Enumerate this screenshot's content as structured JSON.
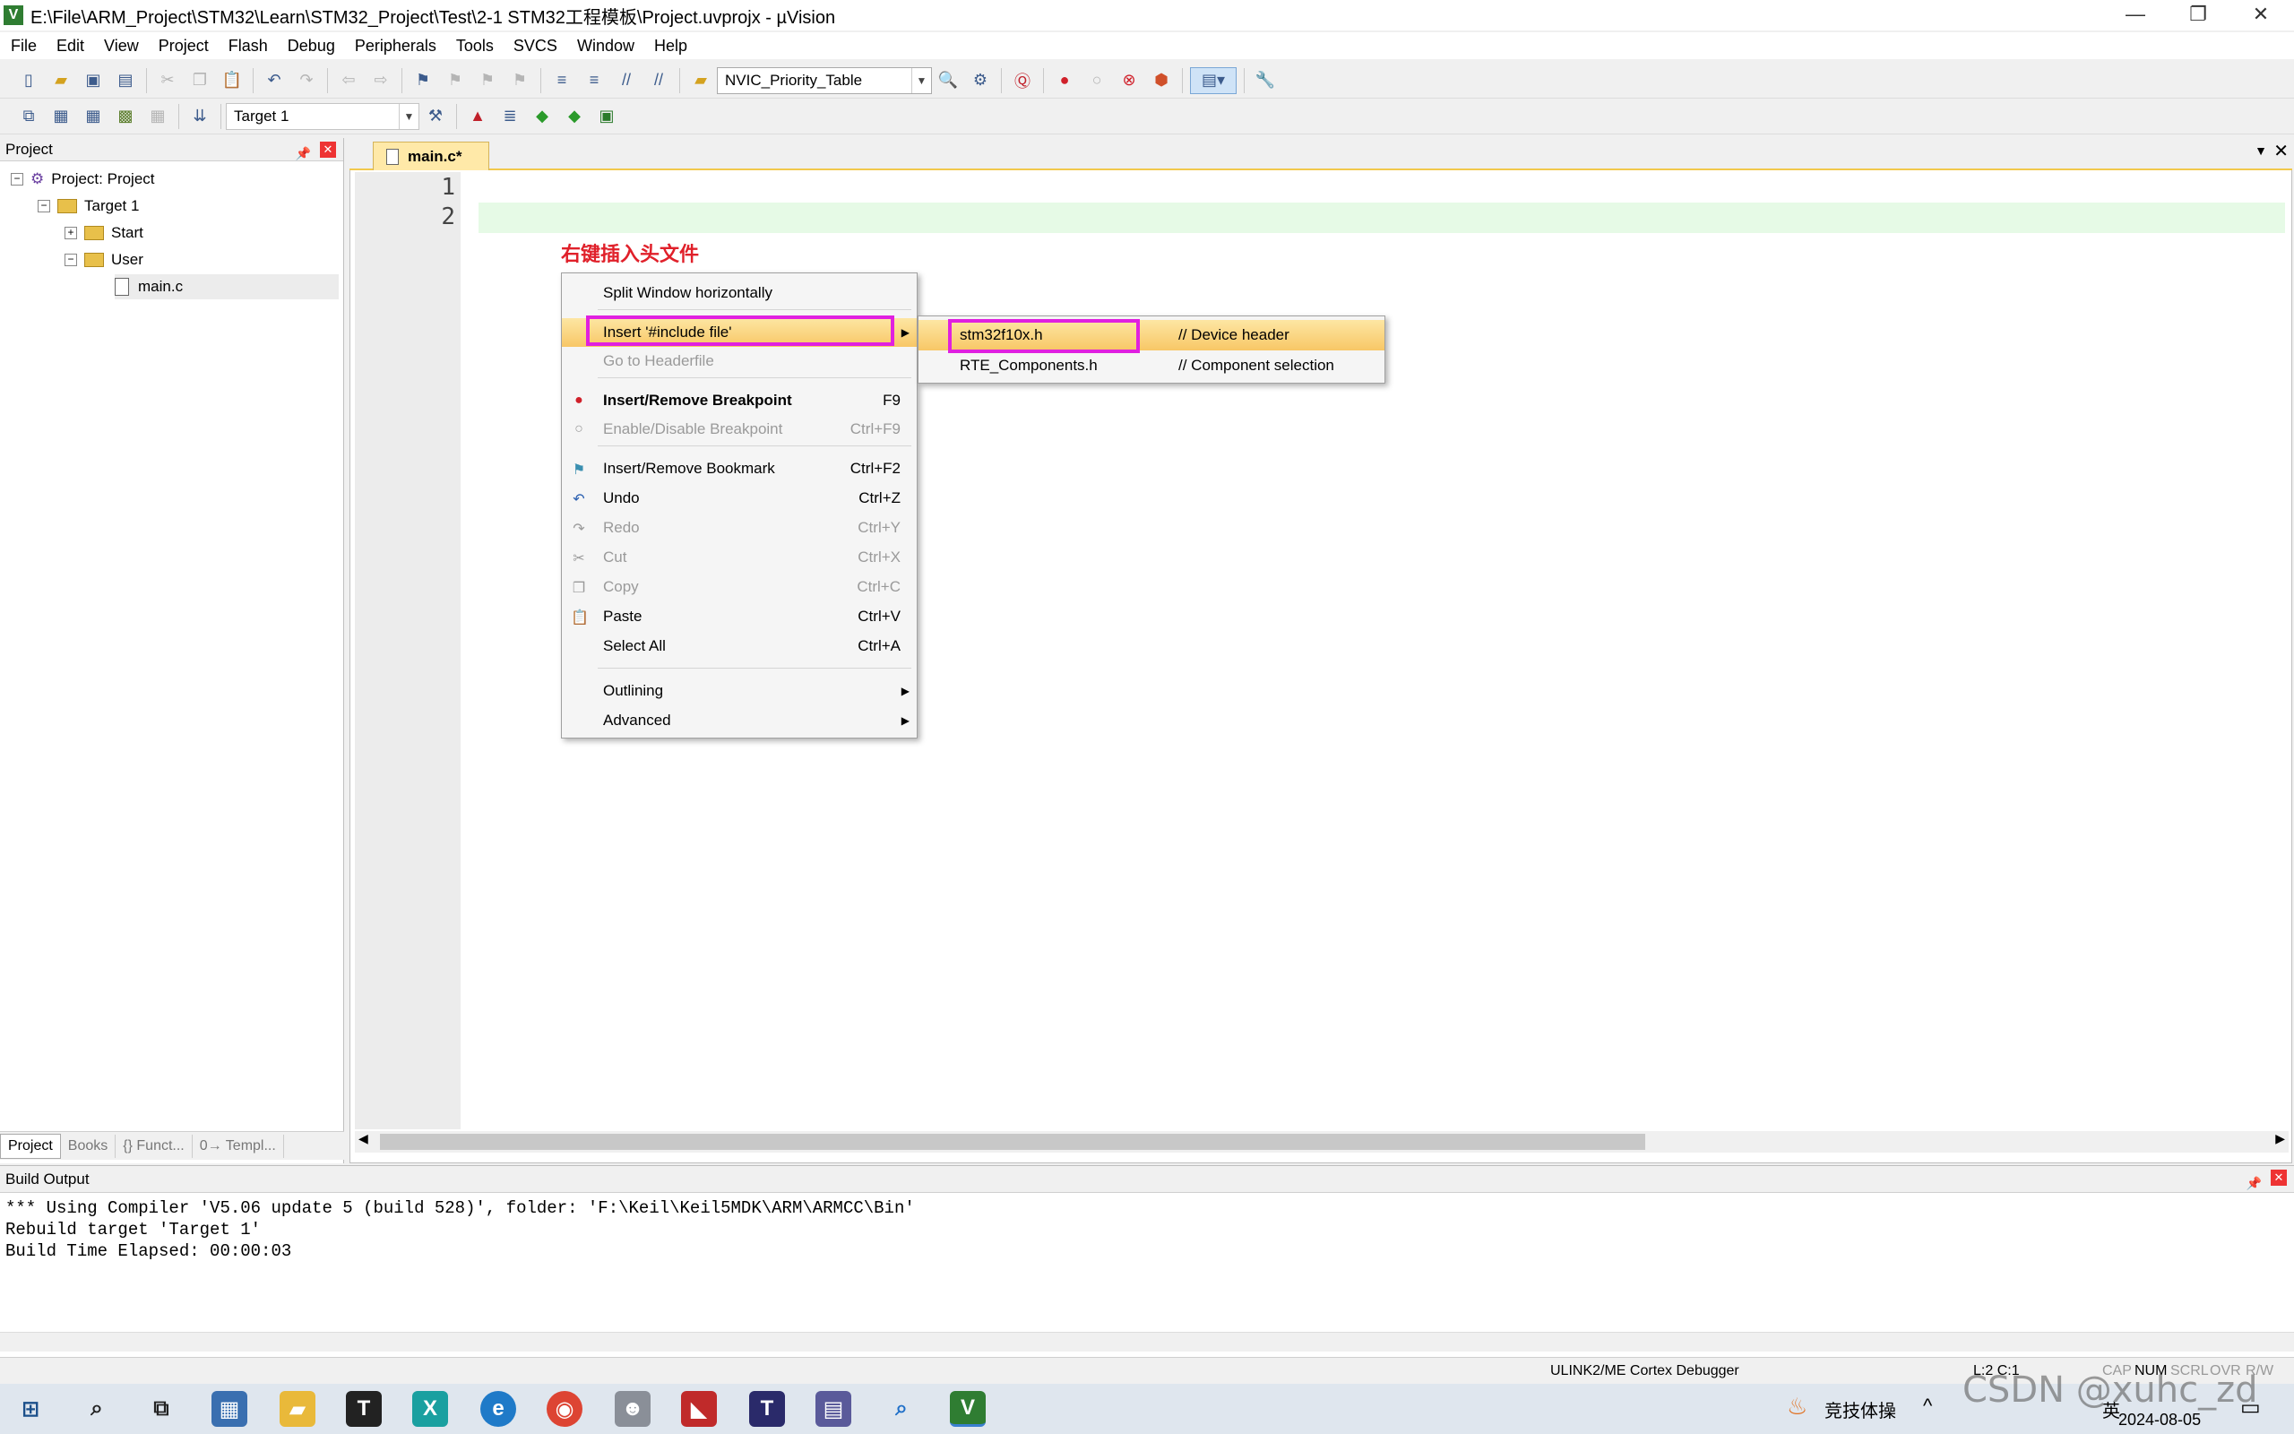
{
  "window": {
    "title": "E:\\File\\ARM_Project\\STM32\\Learn\\STM32_Project\\Test\\2-1 STM32工程模板\\Project.uvprojx - µVision",
    "minimize": "—",
    "maximize": "❐",
    "close": "✕"
  },
  "menu": [
    "File",
    "Edit",
    "View",
    "Project",
    "Flash",
    "Debug",
    "Peripherals",
    "Tools",
    "SVCS",
    "Window",
    "Help"
  ],
  "toolbar": {
    "find_combo_value": "NVIC_Priority_Table",
    "target_combo_value": "Target 1"
  },
  "project_panel": {
    "title": "Project",
    "tree": {
      "root": "Project: Project",
      "target": "Target 1",
      "groups": [
        "Start",
        "User"
      ],
      "file": "main.c"
    },
    "tabs": [
      "Project",
      "Books",
      "{} Funct...",
      "0→ Templ..."
    ]
  },
  "editor": {
    "tab_label": "main.c*",
    "line_numbers": [
      "1",
      "2"
    ],
    "annotation": "右键插入头文件"
  },
  "context_menu": {
    "items": [
      {
        "label": "Split Window horizontally",
        "shortcut": ""
      },
      {
        "label": "Insert '#include file'",
        "shortcut": ""
      },
      {
        "label": "Go to Headerfile",
        "shortcut": ""
      },
      {
        "label": "Insert/Remove Breakpoint",
        "shortcut": "F9"
      },
      {
        "label": "Enable/Disable Breakpoint",
        "shortcut": "Ctrl+F9"
      },
      {
        "label": "Insert/Remove Bookmark",
        "shortcut": "Ctrl+F2"
      },
      {
        "label": "Undo",
        "shortcut": "Ctrl+Z"
      },
      {
        "label": "Redo",
        "shortcut": "Ctrl+Y"
      },
      {
        "label": "Cut",
        "shortcut": "Ctrl+X"
      },
      {
        "label": "Copy",
        "shortcut": "Ctrl+C"
      },
      {
        "label": "Paste",
        "shortcut": "Ctrl+V"
      },
      {
        "label": "Select All",
        "shortcut": "Ctrl+A"
      },
      {
        "label": "Outlining",
        "shortcut": ""
      },
      {
        "label": "Advanced",
        "shortcut": ""
      }
    ]
  },
  "submenu": {
    "items": [
      {
        "file": "stm32f10x.h",
        "comment": "// Device header"
      },
      {
        "file": "RTE_Components.h",
        "comment": "// Component selection"
      }
    ]
  },
  "build_output": {
    "title": "Build Output",
    "lines": [
      "*** Using Compiler 'V5.06 update 5 (build 528)', folder: 'F:\\Keil\\Keil5MDK\\ARM\\ARMCC\\Bin'",
      "Rebuild target 'Target 1'",
      "Build Time Elapsed:  00:00:03"
    ]
  },
  "status": {
    "debugger": "ULINK2/ME Cortex Debugger",
    "position": "L:2 C:1",
    "cap": "CAP",
    "num": "NUM",
    "scrl": "SCRL",
    "ovr": "OVR",
    "rw": "R/W"
  },
  "taskbar": {
    "notification": "竞技体操",
    "ime": "英",
    "date": "2024-08-05"
  },
  "watermark": "CSDN @xuhc_zd",
  "colors": {
    "highlight_line": "#e6fae6",
    "annotation": "#e0202a",
    "frame": "#e020e0",
    "menu_hover": "#f8c766"
  }
}
